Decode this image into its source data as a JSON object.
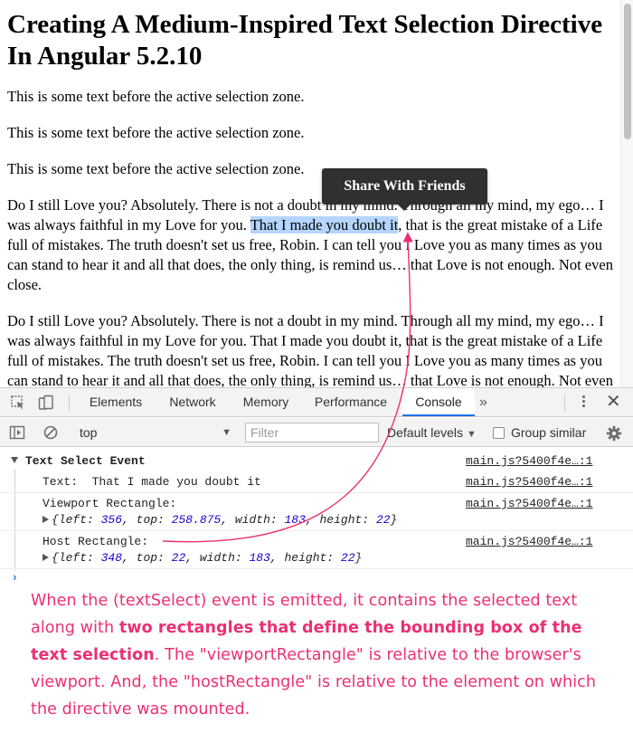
{
  "page": {
    "title": "Creating A Medium-Inspired Text Selection Directive In Angular 5.2.10",
    "intro_lines": [
      "This is some text before the active selection zone.",
      "This is some text before the active selection zone.",
      "This is some text before the active selection zone."
    ],
    "paragraph_before": "Do I still Love you? Absolutely. There is not a doubt in my mind. Through all my mind, my ego… I was always faithful in my Love for you. ",
    "paragraph_selected": "That I made you doubt it",
    "paragraph_after": ", that is the great mistake of a Life full of mistakes. The truth doesn't set us free, Robin. I can tell you I Love you as many times as you can stand to hear it and all that does, the only thing, is remind us… that Love is not enough. Not even close.",
    "paragraph_second": "Do I still Love you? Absolutely. There is not a doubt in my mind. Through all my mind, my ego… I was always faithful in my Love for you. That I made you doubt it, that is the great mistake of a Life full of mistakes. The truth doesn't set us free, Robin. I can tell you I Love you as many times as you can stand to hear it and all that does, the only thing, is remind us… that Love is not enough. Not even close.",
    "tooltip_label": "Share With Friends"
  },
  "devtools": {
    "tabs": [
      {
        "label": "Elements"
      },
      {
        "label": "Network"
      },
      {
        "label": "Memory"
      },
      {
        "label": "Performance"
      },
      {
        "label": "Console"
      }
    ],
    "active_tab": "Console",
    "more_label": "»",
    "close_label": "✕",
    "context": "top",
    "filter_placeholder": "Filter",
    "levels_label": "Default levels",
    "group_similar_label": "Group similar"
  },
  "console": {
    "group_label": "Text Select Event",
    "source_link": "main.js?5400f4e…:1",
    "text_line": "Text:  That I made you doubt it",
    "viewport_label": "Viewport Rectangle:",
    "viewport_rect": {
      "left": "356",
      "top": "258.875",
      "width": "183",
      "height": "22"
    },
    "host_label": "Host Rectangle:",
    "host_rect": {
      "left": "348",
      "top": "22",
      "width": "183",
      "height": "22"
    },
    "prompt_symbol": "›"
  },
  "annotation": {
    "part1": "When the ",
    "event_name": "(textSelect) event is emitted",
    "part2": ", it contains the selected text along with ",
    "emphasis": "two rectangles that define the bounding box of the text selection",
    "part3": ". The ",
    "viewport_term": "\"viewportRectangle\"",
    "part4": " is relative to the browser's viewport. And, the ",
    "host_term": "\"hostRectangle\"",
    "part5": " is relative to the element on which the directive was mounted.",
    "color": "#ec2f73"
  },
  "colors": {
    "selection": "#b4d5fe",
    "tooltip_bg": "#303030",
    "number": "#1c00cf",
    "active_tab_underline": "#1a73e8"
  }
}
